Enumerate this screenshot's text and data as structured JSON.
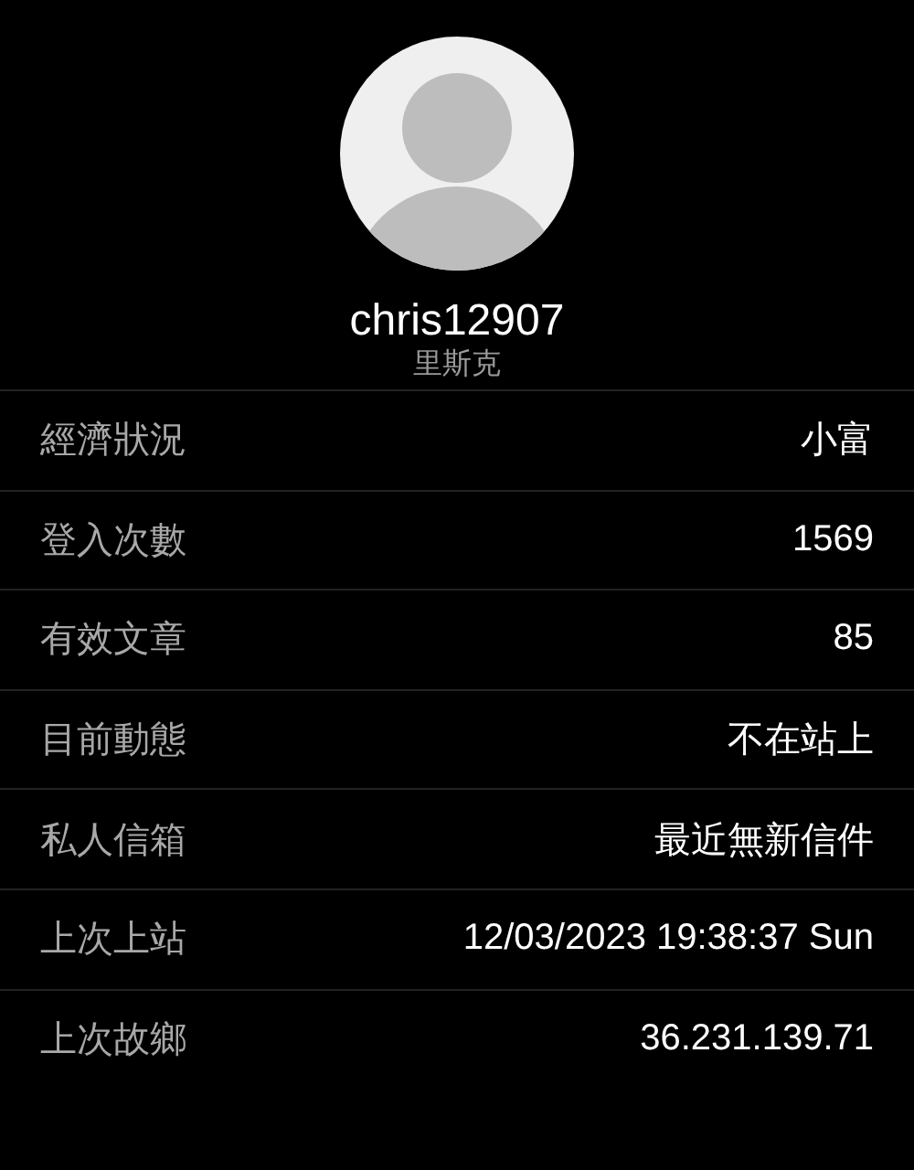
{
  "profile": {
    "username": "chris12907",
    "nickname": "里斯克"
  },
  "rows": [
    {
      "label": "經濟狀況",
      "value": "小富"
    },
    {
      "label": "登入次數",
      "value": "1569"
    },
    {
      "label": "有效文章",
      "value": "85"
    },
    {
      "label": "目前動態",
      "value": "不在站上"
    },
    {
      "label": "私人信箱",
      "value": "最近無新信件"
    },
    {
      "label": "上次上站",
      "value": "12/03/2023 19:38:37 Sun"
    },
    {
      "label": "上次故鄉",
      "value": "36.231.139.71"
    }
  ]
}
